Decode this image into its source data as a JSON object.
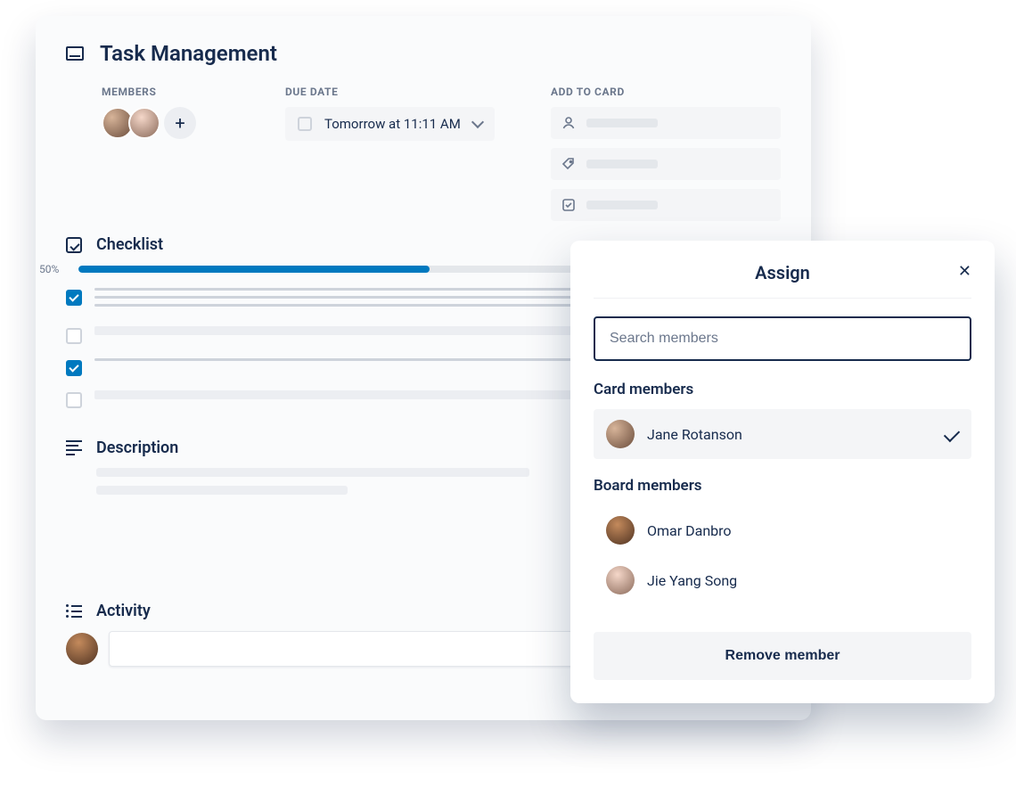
{
  "card": {
    "title": "Task Management",
    "members": {
      "label": "MEMBERS"
    },
    "dueDate": {
      "label": "DUE DATE",
      "value": "Tomorrow at 11:11 AM"
    },
    "checklist": {
      "title": "Checklist",
      "progressPercent": 50,
      "progressLabel": "50%",
      "items": [
        {
          "checked": true
        },
        {
          "checked": false
        },
        {
          "checked": true
        },
        {
          "checked": false
        }
      ]
    },
    "description": {
      "title": "Description"
    },
    "activity": {
      "title": "Activity"
    }
  },
  "sidebar": {
    "label": "ADD TO CARD"
  },
  "assign": {
    "title": "Assign",
    "searchPlaceholder": "Search members",
    "cardMembersLabel": "Card members",
    "boardMembersLabel": "Board members",
    "cardMembers": [
      {
        "name": "Jane Rotanson",
        "selected": true
      }
    ],
    "boardMembers": [
      {
        "name": "Omar Danbro",
        "selected": false
      },
      {
        "name": "Jie Yang Song",
        "selected": false
      }
    ],
    "removeLabel": "Remove member"
  },
  "colors": {
    "accent": "#0079BF",
    "text": "#172B4D",
    "muted": "#6B778C",
    "surface": "#F4F5F7"
  }
}
